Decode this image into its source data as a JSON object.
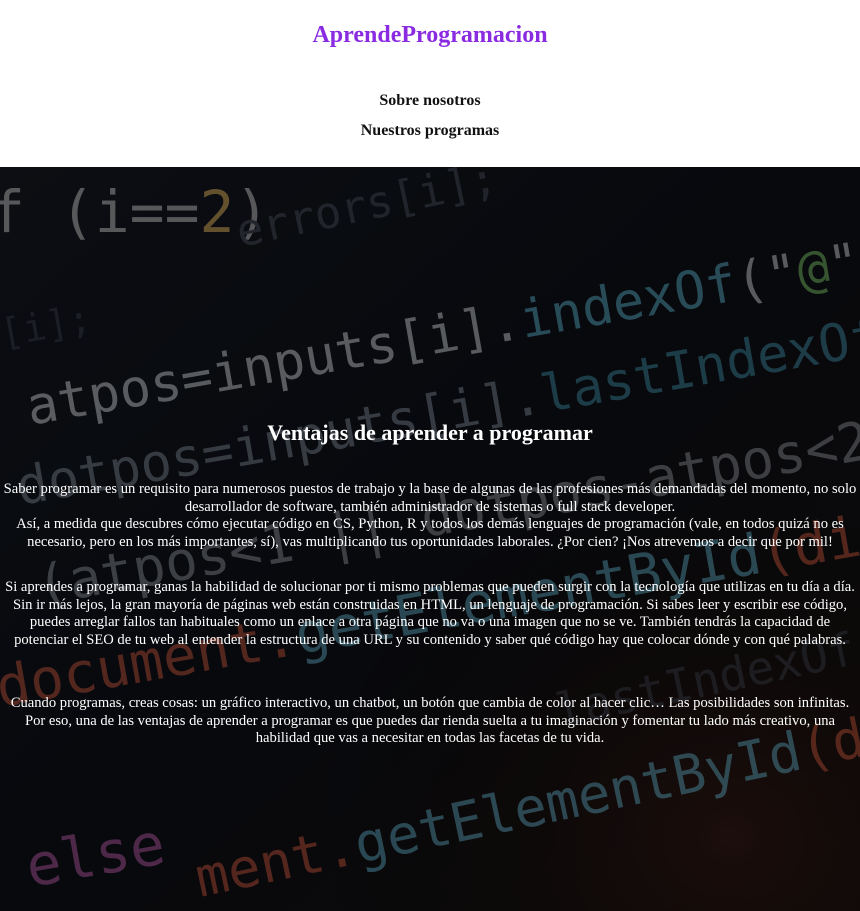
{
  "header": {
    "brand": "AprendeProgramacion",
    "nav": [
      "Sobre nosotros",
      "Nuestros programas"
    ]
  },
  "hero": {
    "background": "code-screen-background",
    "title": "Ventajas de aprender a programar",
    "paragraphs": [
      {
        "lines": [
          "Saber programar es un requisito para numerosos puestos de trabajo y la base de algunas de las profesiones más demandadas del momento, no solo desarrollador de software, también administrador de sistemas o full stack developer.",
          "Así, a medida que descubres cómo ejecutar código en CS, Python, R y todos los demás lenguajes de programación (vale, en todos quizá no es necesario, pero en los más importantes, sí), vas multiplicando tus oportunidades laborales. ¿Por cien? ¡Nos atrevemos a decir que por mil!"
        ]
      },
      {
        "lines": [
          "Si aprendes a programar, ganas la habilidad de solucionar por ti mismo problemas que pueden surgir con la tecnología que utilizas en tu día a día.",
          "Sin ir más lejos, la gran mayoría de páginas web están construidas en HTML, un lenguaje de programación. Si sabes leer y escribir ese código, puedes arreglar fallos tan habituales como un enlace a otra página que no va o una imagen que no se ve. También tendrás la capacidad de potenciar el SEO de tu web al entender la estructura de una URL y su contenido y saber qué código hay que colocar dónde y con qué palabras."
        ]
      },
      {
        "lines": [
          "Cuando programas, creas cosas: un gráfico interactivo, un chatbot, un botón que cambia de color al hacer clic… Las posibilidades son infinitas.",
          "Por eso, una de las ventajas de aprender a programar es que puedes dar rienda suelta a tu imaginación y fomentar tu lado más creativo, una habilidad que vas a necesitar en todas las facetas de tu vida."
        ]
      }
    ]
  },
  "colors": {
    "brand": "#8a2be2",
    "hero_bg": "#0b0d12",
    "hero_text": "#ffffff"
  }
}
